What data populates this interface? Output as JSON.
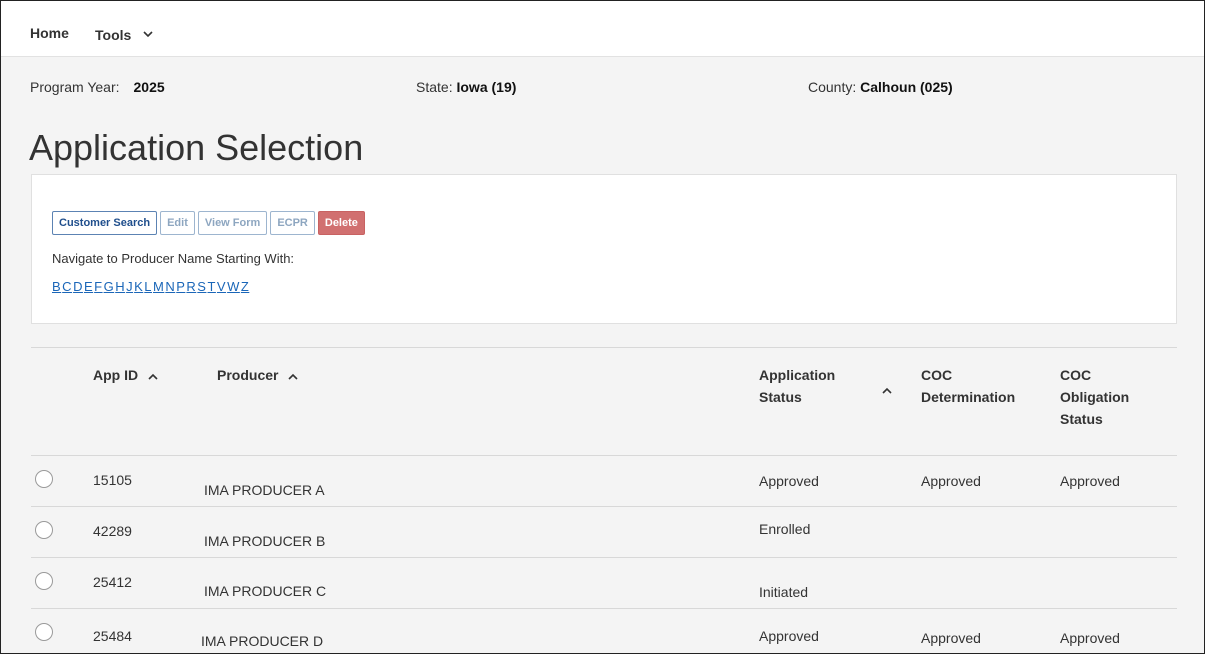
{
  "nav": {
    "home": "Home",
    "tools": "Tools",
    "tools_chevron": "⌄"
  },
  "meta": {
    "program_year_label": "Program Year:",
    "program_year": "2025",
    "state_label": "State:",
    "state": "Iowa (19)",
    "county_label": "County:",
    "county": "Calhoun (025)"
  },
  "page_title": "Application Selection",
  "toolbar": {
    "customer_search": "Customer Search",
    "edit": "Edit",
    "view_form": "View Form",
    "ecpr": "ECPR",
    "delete": "Delete"
  },
  "navigate_label": "Navigate to Producer Name Starting With:",
  "letters": [
    "B",
    "C",
    "D",
    "E",
    "F",
    "G",
    "H",
    "J",
    "K",
    "L",
    "M",
    "N",
    "P",
    "R",
    "S",
    "T",
    "V",
    "W",
    "Z"
  ],
  "table": {
    "headers": {
      "app_id": "App ID",
      "producer": "Producer",
      "app_status_line1": "Application",
      "app_status_line2": "Status",
      "coc_det_line1": "COC",
      "coc_det_line2": "Determination",
      "coc_obl_line1": "COC",
      "coc_obl_line2": "Obligation",
      "coc_obl_line3": "Status",
      "sort_up": "^"
    },
    "rows": [
      {
        "app_id": "15105",
        "producer": "IMA PRODUCER A",
        "status": "Approved",
        "coc_det": "Approved",
        "coc_obl": "Approved"
      },
      {
        "app_id": "42289",
        "producer": "IMA PRODUCER B",
        "status": "Enrolled",
        "coc_det": "",
        "coc_obl": ""
      },
      {
        "app_id": "25412",
        "producer": "IMA PRODUCER C",
        "status": "Initiated",
        "coc_det": "",
        "coc_obl": ""
      },
      {
        "app_id": "25484",
        "producer": "IMA PRODUCER D",
        "status": "Approved",
        "coc_det": "Approved",
        "coc_obl": "Approved"
      }
    ]
  }
}
